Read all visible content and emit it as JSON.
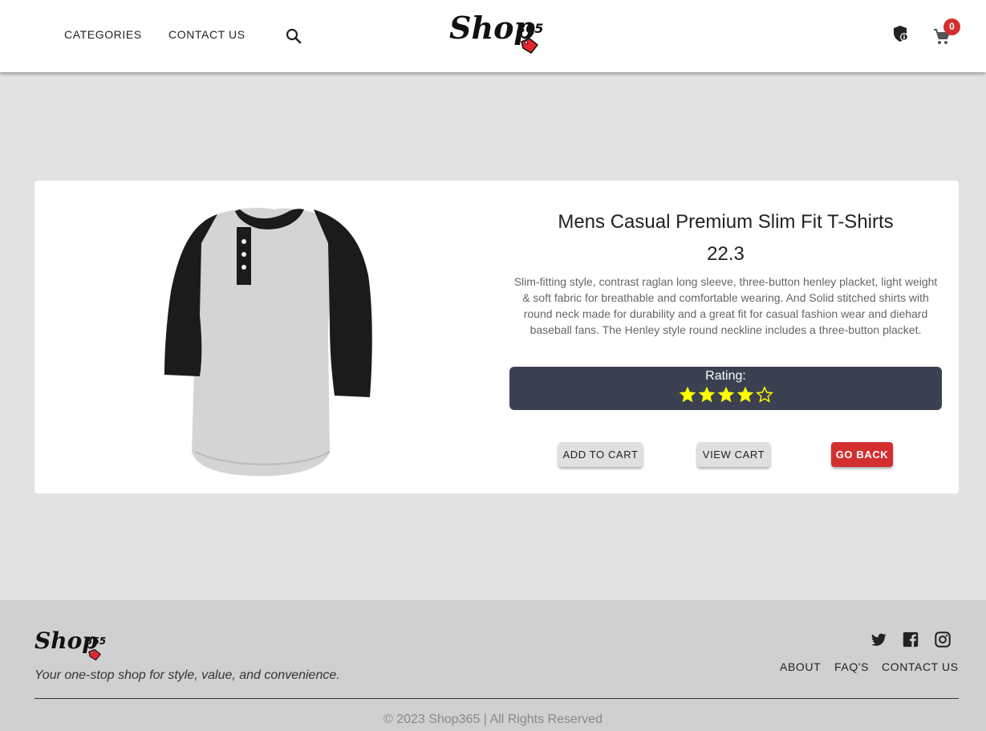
{
  "brand": {
    "name": "Shop",
    "number": "365"
  },
  "header": {
    "nav": [
      "CATEGORIES",
      "CONTACT US"
    ],
    "search_icon": "search-icon",
    "cart_count": "0",
    "icons": [
      "shield-lock-icon",
      "cart-icon"
    ]
  },
  "product": {
    "title": "Mens Casual Premium Slim Fit T-Shirts",
    "price": "22.3",
    "description": "Slim-fitting style, contrast raglan long sleeve, three-button henley placket, light weight & soft fabric for breathable and comfortable wearing. And Solid stitched shirts with round neck made for durability and a great fit for casual fashion wear and diehard baseball fans. The Henley style round neckline includes a three-button placket.",
    "rating_label": "Rating:",
    "rating_stars": 4,
    "rating_max": 5
  },
  "buttons": {
    "add_to_cart": "ADD TO CART",
    "view_cart": "VIEW CART",
    "go_back": "GO BACK"
  },
  "footer": {
    "tagline": "Your one-stop shop for style, value, and convenience.",
    "links": [
      "ABOUT",
      "FAQ'S",
      "CONTACT US"
    ],
    "social": [
      "twitter-icon",
      "facebook-icon",
      "instagram-icon"
    ],
    "copyright": "© 2023 Shop365 | All Rights Reserved"
  },
  "colors": {
    "header_bg": "#ffffff",
    "page_bg": "#e2e2e2",
    "rating_bg": "#3b4150",
    "star": "#ffff00",
    "danger": "#d32f2f",
    "footer_bg": "#d0d0d0"
  }
}
